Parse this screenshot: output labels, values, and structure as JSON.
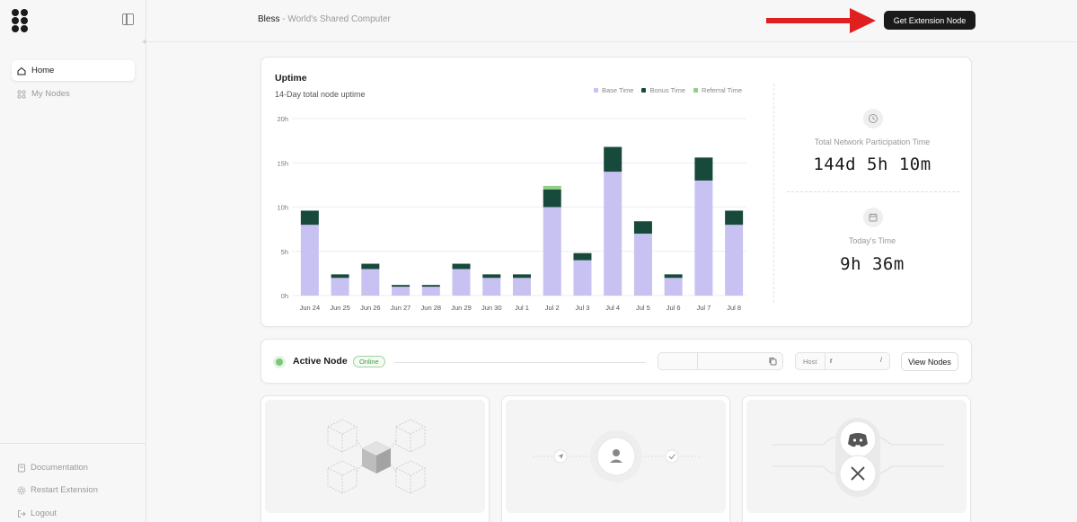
{
  "sidebar": {
    "items": [
      {
        "label": "Home",
        "icon": "home-icon",
        "active": true
      },
      {
        "label": "My Nodes",
        "icon": "nodes-icon",
        "active": false
      }
    ],
    "bottom_items": [
      {
        "label": "Documentation",
        "icon": "document-icon"
      },
      {
        "label": "Restart Extension",
        "icon": "settings-icon"
      },
      {
        "label": "Logout",
        "icon": "logout-icon"
      }
    ]
  },
  "header": {
    "brand_name": "Bless",
    "tagline": " - World's Shared Computer",
    "cta_label": "Get Extension Node",
    "arrow_color": "#e02020"
  },
  "uptime": {
    "title": "Uptime",
    "subtitle": "14-Day total node uptime",
    "legend": [
      {
        "label": "Base Time",
        "color": "#c7c2f2"
      },
      {
        "label": "Bonus Time",
        "color": "#184a3c"
      },
      {
        "label": "Referral Time",
        "color": "#8fcf86"
      }
    ],
    "stats": {
      "participation_label": "Total Network Participation Time",
      "participation_value": "144d 5h 10m",
      "today_label": "Today's Time",
      "today_value": "9h 36m"
    }
  },
  "chart_data": {
    "type": "bar",
    "stacked": true,
    "categories": [
      "Jun 24",
      "Jun 25",
      "Jun 26",
      "Jun 27",
      "Jun 28",
      "Jun 29",
      "Jun 30",
      "Jul 1",
      "Jul 2",
      "Jul 3",
      "Jul 4",
      "Jul 5",
      "Jul 6",
      "Jul 7",
      "Jul 8"
    ],
    "series": [
      {
        "name": "Base Time",
        "values": [
          8,
          2,
          3,
          1,
          1,
          3,
          2,
          2,
          10,
          4,
          14,
          7,
          2,
          13,
          8
        ]
      },
      {
        "name": "Bonus Time",
        "values": [
          1.6,
          0.4,
          0.6,
          0.2,
          0.2,
          0.6,
          0.4,
          0.4,
          2,
          0.8,
          2.8,
          1.4,
          0.4,
          2.6,
          1.6
        ]
      },
      {
        "name": "Referral Time",
        "values": [
          0,
          0,
          0,
          0,
          0,
          0,
          0,
          0,
          0.4,
          0,
          0,
          0,
          0,
          0,
          0
        ]
      }
    ],
    "yticks": [
      "0h",
      "5h",
      "10h",
      "15h",
      "20h"
    ],
    "ylim": [
      0,
      20
    ],
    "grid": true,
    "legend_position": "top-right"
  },
  "node": {
    "title": "Active Node",
    "status": "Online",
    "host_label": "Host",
    "host_value": "r",
    "view_label": "View Nodes"
  }
}
